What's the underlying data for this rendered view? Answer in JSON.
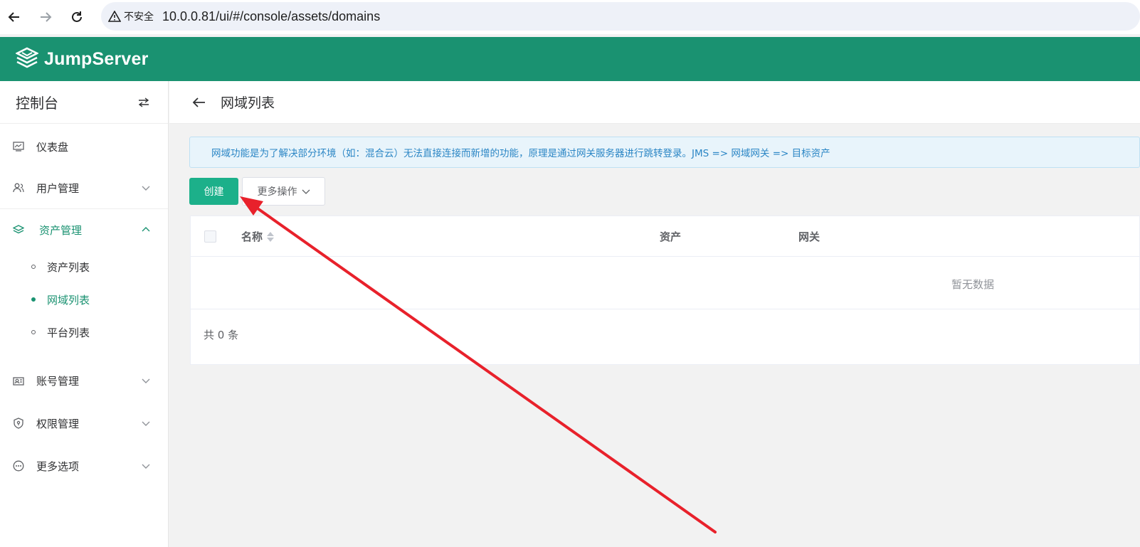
{
  "browser": {
    "security_label": "不安全",
    "url": "10.0.0.81/ui/#/console/assets/domains"
  },
  "header": {
    "brand": "JumpServer"
  },
  "sidebar": {
    "title": "控制台",
    "items": [
      {
        "label": "仪表盘",
        "icon": "dashboard-icon",
        "has_children": false
      },
      {
        "label": "用户管理",
        "icon": "users-icon",
        "has_children": true,
        "expanded": false
      },
      {
        "label": "资产管理",
        "icon": "layers-icon",
        "has_children": true,
        "expanded": true,
        "active": true,
        "children": [
          {
            "label": "资产列表",
            "active": false
          },
          {
            "label": "网域列表",
            "active": true
          },
          {
            "label": "平台列表",
            "active": false
          }
        ]
      },
      {
        "label": "账号管理",
        "icon": "account-icon",
        "has_children": true,
        "expanded": false
      },
      {
        "label": "权限管理",
        "icon": "shield-icon",
        "has_children": true,
        "expanded": false
      },
      {
        "label": "更多选项",
        "icon": "more-icon",
        "has_children": true,
        "expanded": false
      }
    ]
  },
  "page": {
    "title": "网域列表",
    "notice": "网域功能是为了解决部分环境（如：混合云）无法直接连接而新增的功能，原理是通过网关服务器进行跳转登录。JMS => 网域网关 => 目标资产",
    "create_label": "创建",
    "more_actions_label": "更多操作"
  },
  "table": {
    "columns": [
      "名称",
      "资产",
      "网关"
    ],
    "empty_text": "暂无数据",
    "total_text": "共 0 条"
  },
  "colors": {
    "brand": "#1a9271",
    "primary_button": "#1cb08a",
    "annotation_arrow": "#e8212b"
  }
}
